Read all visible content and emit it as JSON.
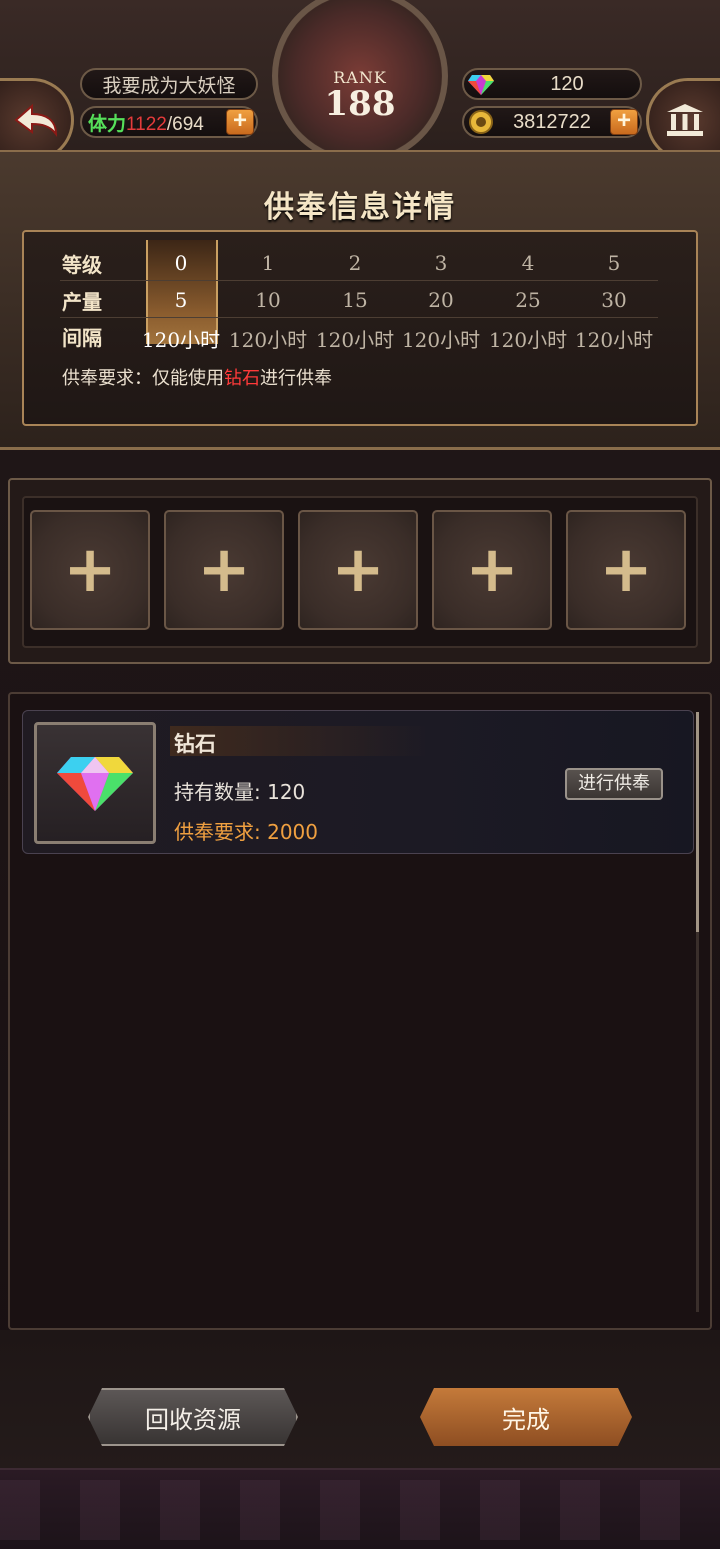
{
  "header": {
    "player_name": "我要成为大妖怪",
    "stamina_label": "体力",
    "stamina_current": "1122",
    "stamina_max": "/694",
    "gems": "120",
    "gold": "3812722",
    "rank_label": "RANK",
    "rank_value": "188"
  },
  "info": {
    "title": "供奉信息详情",
    "row_labels": {
      "level": "等级",
      "output": "产量",
      "interval": "间隔"
    },
    "columns": [
      {
        "level": "0",
        "output": "5",
        "interval": "120小时"
      },
      {
        "level": "1",
        "output": "10",
        "interval": "120小时"
      },
      {
        "level": "2",
        "output": "15",
        "interval": "120小时"
      },
      {
        "level": "3",
        "output": "20",
        "interval": "120小时"
      },
      {
        "level": "4",
        "output": "25",
        "interval": "120小时"
      },
      {
        "level": "5",
        "output": "30",
        "interval": "120小时"
      }
    ],
    "requirement_prefix": "供奉要求：仅能使用",
    "requirement_highlight": "钻石",
    "requirement_suffix": "进行供奉"
  },
  "slots": {
    "plus": "+"
  },
  "item": {
    "name": "钻石",
    "count_label": "持有数量: 120",
    "requirement_label": "供奉要求: 2000",
    "offer_button": "进行供奉"
  },
  "footer": {
    "recycle_button": "回收资源",
    "done_button": "完成"
  },
  "colors": {
    "stamina_label": "#56e05a",
    "stamina_current": "#e33b3b",
    "requirement_highlight": "#ff3a3a",
    "item_requirement": "#f0a040",
    "done_button": "#c47a3a"
  }
}
